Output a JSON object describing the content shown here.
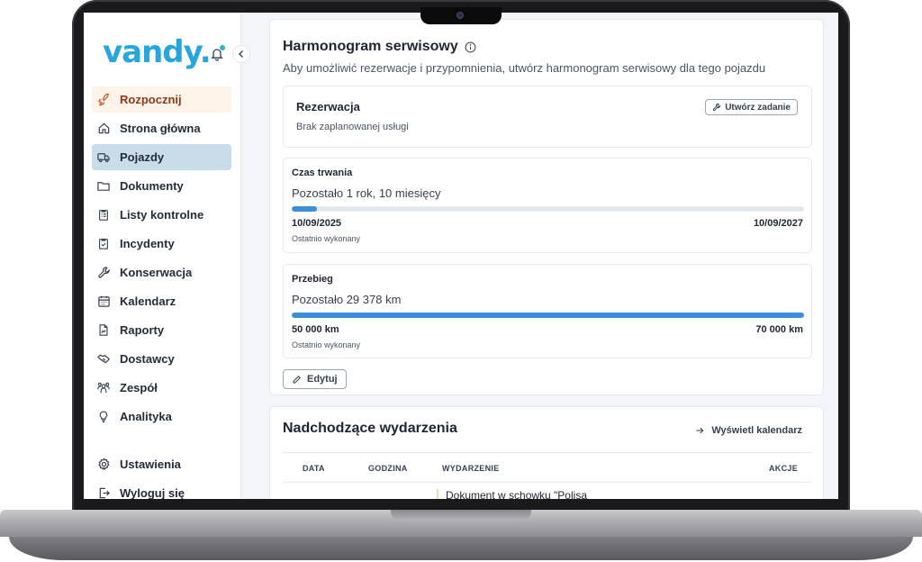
{
  "sidebar": {
    "logo": "vandy.",
    "items": [
      {
        "label": "Rozpocznij",
        "icon": "rocket-icon"
      },
      {
        "label": "Strona główna",
        "icon": "home-icon"
      },
      {
        "label": "Pojazdy",
        "icon": "truck-icon"
      },
      {
        "label": "Dokumenty",
        "icon": "folder-icon"
      },
      {
        "label": "Listy kontrolne",
        "icon": "clipboard-list-icon"
      },
      {
        "label": "Incydenty",
        "icon": "clipboard-check-icon"
      },
      {
        "label": "Konserwacja",
        "icon": "wrench-icon"
      },
      {
        "label": "Kalendarz",
        "icon": "calendar-icon"
      },
      {
        "label": "Raporty",
        "icon": "report-icon"
      },
      {
        "label": "Dostawcy",
        "icon": "handshake-icon"
      },
      {
        "label": "Zespół",
        "icon": "team-icon"
      },
      {
        "label": "Analityka",
        "icon": "lightbulb-icon"
      }
    ],
    "bottom": [
      {
        "label": "Ustawienia",
        "icon": "gear-icon"
      },
      {
        "label": "Wyloguj się",
        "icon": "logout-icon"
      }
    ],
    "active_item": "Pojazdy"
  },
  "schedule": {
    "title": "Harmonogram serwisowy",
    "subtitle": "Aby umożliwić rezerwacje i przypomnienia, utwórz harmonogram serwisowy dla tego pojazdu",
    "reservation": {
      "title": "Rezerwacja",
      "status": "Brak zaplanowanej usługi",
      "create_task_label": "Utwórz zadanie"
    },
    "duration": {
      "label": "Czas trwania",
      "remaining": "Pozostało 1 rok, 10 miesięcy",
      "progress": 0.05,
      "start": "10/09/2025",
      "end": "10/09/2027",
      "last_done": "Ostatnio wykonany"
    },
    "mileage": {
      "label": "Przebieg",
      "remaining": "Pozostało 29 378 km",
      "progress": 1.0,
      "start": "50 000 km",
      "end": "70 000 km",
      "last_done": "Ostatnio wykonany"
    },
    "edit_label": "Edytuj"
  },
  "events": {
    "title": "Nadchodzące wydarzenia",
    "calendar_link": "Wyświetl kalendarz",
    "columns": [
      "DATA",
      "GODZINA",
      "WYDARZENIE",
      "AKCJE"
    ],
    "first_row_event": "Dokument w schowku \"Polisa"
  },
  "colors": {
    "brand": "#27a6de",
    "progress": "#3b8fd9",
    "active_nav": "#c9dcea",
    "start_nav": "#fdf3e9"
  }
}
